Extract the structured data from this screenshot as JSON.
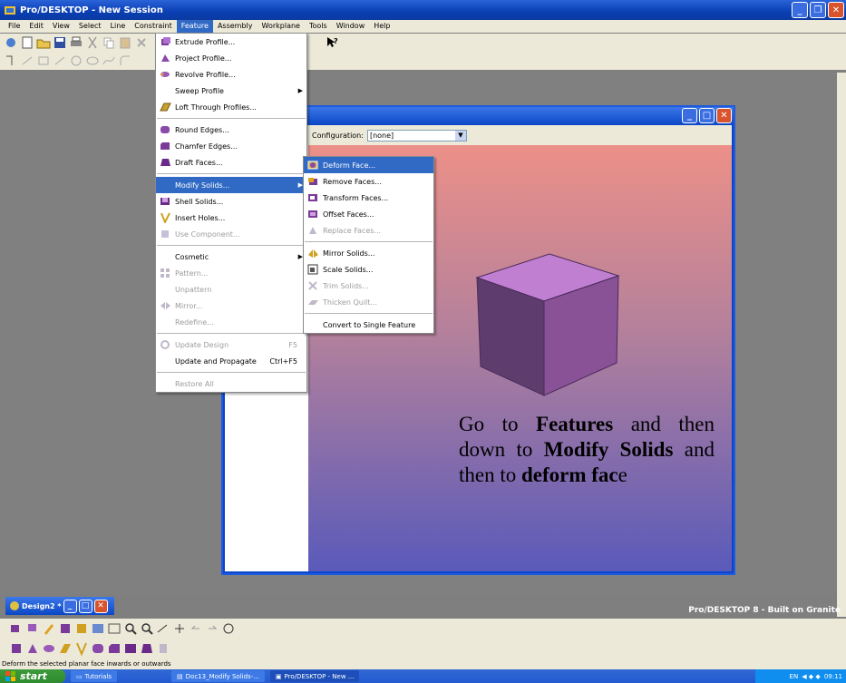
{
  "app": {
    "title": "Pro/DESKTOP - New Session"
  },
  "menubar": [
    "File",
    "Edit",
    "View",
    "Select",
    "Line",
    "Constraint",
    "Feature",
    "Assembly",
    "Workplane",
    "Tools",
    "Window",
    "Help"
  ],
  "feature_menu": {
    "extrude": "Extrude Profile...",
    "project": "Project Profile...",
    "revolve": "Revolve Profile...",
    "sweep": "Sweep Profile",
    "loft": "Loft Through Profiles...",
    "round": "Round Edges...",
    "chamfer": "Chamfer Edges...",
    "draft": "Draft Faces...",
    "modify": "Modify Solids...",
    "shell": "Shell Solids...",
    "insert_holes": "Insert Holes...",
    "use_component": "Use Component...",
    "cosmetic": "Cosmetic",
    "pattern": "Pattern...",
    "unpattern": "Unpattern",
    "mirror": "Mirror...",
    "redefine": "Redefine...",
    "update_design": "Update Design",
    "update_design_sc": "F5",
    "update_propagate": "Update and Propagate",
    "update_propagate_sc": "Ctrl+F5",
    "restore_all": "Restore All"
  },
  "modify_submenu": {
    "deform": "Deform Face...",
    "remove": "Remove Faces...",
    "transform": "Transform Faces...",
    "offset": "Offset Faces...",
    "replace": "Replace Faces...",
    "mirror_solids": "Mirror Solids...",
    "scale_solids": "Scale Solids...",
    "trim_solids": "Trim Solids...",
    "thicken_quilt": "Thicken Quilt...",
    "convert": "Convert to Single Feature"
  },
  "design_window": {
    "config_label": "Configuration:",
    "config_value": "[none]"
  },
  "instruction": {
    "t1": "Go to ",
    "b1": "Features",
    "t2": " and then down to ",
    "b2": "Modify Solids",
    "t3": " and then to ",
    "b3": "deform fac",
    "t4": "e"
  },
  "doc_tab": {
    "label": "Design2 *"
  },
  "brand": "Pro/DESKTOP 8 - Built on Granite",
  "status": "Deform the selected planar face inwards or outwards",
  "taskbar": {
    "start": "start",
    "tasks": [
      "Tutorials",
      "Doc13_Modify Solids-...",
      "Pro/DESKTOP - New ..."
    ],
    "lang": "EN",
    "clock": "09:11"
  },
  "colors": {
    "menu_highlight": "#316ac5",
    "titlebar": "#0a3fb3",
    "cube_top": "#c07fd0",
    "cube_left": "#5e3d6e",
    "cube_right": "#8a5296"
  }
}
